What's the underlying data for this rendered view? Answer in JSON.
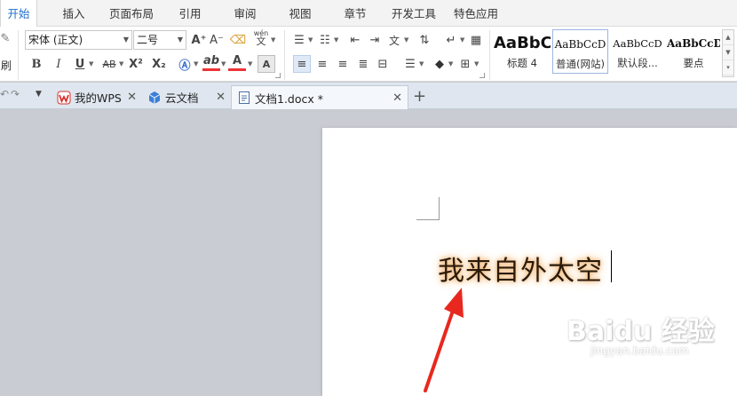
{
  "menu": {
    "tabs": [
      "开始",
      "插入",
      "页面布局",
      "引用",
      "审阅",
      "视图",
      "章节",
      "开发工具",
      "特色应用"
    ],
    "active_index": 0
  },
  "ribbon": {
    "format_painter_label": "刷",
    "font_name": "宋体 (正文)",
    "font_size": "二号",
    "bold": "B",
    "italic": "I",
    "underline": "U",
    "strikethrough": "AB",
    "superscript": "X²",
    "subscript": "X₂",
    "font_color_letter": "A",
    "highlight_letter": "ab",
    "grow_font": "A⁺",
    "shrink_font": "A⁻",
    "phonetic_top": "wén",
    "phonetic_bottom": "文",
    "styles": [
      {
        "sample": "AaBbC",
        "name": "标题 4"
      },
      {
        "sample": "AaBbCcD",
        "name": "普通(网站)"
      },
      {
        "sample": "AaBbCcD",
        "name": "默认段..."
      },
      {
        "sample": "AaBbCcD",
        "name": "要点"
      }
    ]
  },
  "tabs": {
    "items": [
      {
        "label": "我的WPS"
      },
      {
        "label": "云文档"
      },
      {
        "label": "文档1.docx *"
      }
    ],
    "add_symbol": "+"
  },
  "document": {
    "text": "我来自外太空"
  },
  "watermark": {
    "brand": "Baidu 经验",
    "url": "jingyan.baidu.com"
  },
  "colors": {
    "accent": "#1f6fd0",
    "wps_red": "#d9302e",
    "arrow_red": "#e8281e",
    "glow": "#f0b070"
  }
}
